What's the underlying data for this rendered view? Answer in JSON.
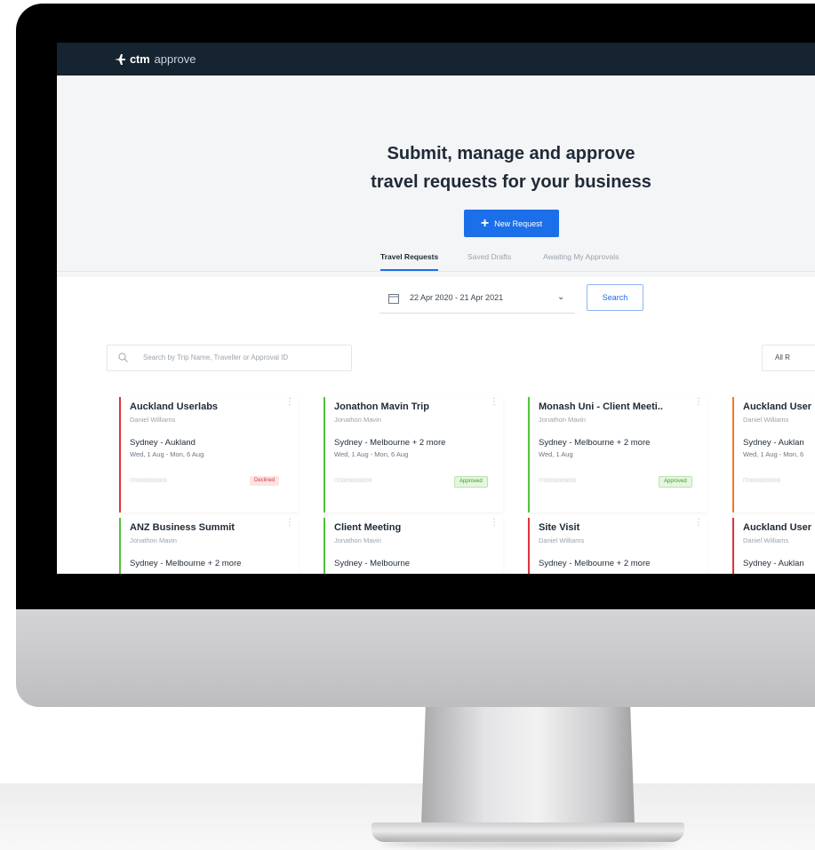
{
  "app": {
    "logo_brand": "ctm",
    "logo_product": "approve"
  },
  "hero": {
    "title_line1": "Submit, manage and approve",
    "title_line2": "travel requests for your business",
    "new_request_label": "New Request"
  },
  "tabs": [
    {
      "label": "Travel Requests",
      "active": true
    },
    {
      "label": "Saved Drafts",
      "active": false
    },
    {
      "label": "Awaiting My Approvals",
      "active": false
    }
  ],
  "filters": {
    "date_range": "22 Apr 2020 - 21 Apr 2021",
    "search_label": "Search",
    "search_placeholder": "Search by Trip Name, Traveller or Approval ID",
    "status_filter": "All R"
  },
  "colors": {
    "accent": "#1b6fe8",
    "topbar": "#162330",
    "declined": "#e0323c",
    "approved": "#52c23a",
    "pending": "#f07a2a"
  },
  "cards": [
    {
      "name": "Auckland Userlabs",
      "traveller": "Daniel Williams",
      "route": "Sydney - Aukland",
      "dates": "Wed, 1 Aug - Mon, 6 Aug",
      "ref": "IT00000000000",
      "status": "Declined",
      "color": "#e0323c"
    },
    {
      "name": "Jonathon Mavin Trip",
      "traveller": "Jonathon Mavin",
      "route": "Sydney - Melbourne + 2 more",
      "dates": "Wed, 1 Aug - Mon, 6 Aug",
      "ref": "IT00000000000",
      "status": "Approved",
      "color": "#52c23a"
    },
    {
      "name": "Monash Uni - Client Meeti..",
      "traveller": "Jonathon Mavin",
      "route": "Sydney - Melbourne + 2 more",
      "dates": "Wed, 1 Aug",
      "ref": "IT00000000000",
      "status": "Approved",
      "color": "#52c23a"
    },
    {
      "name": "Auckland User",
      "traveller": "Daniel Williams",
      "route": "Sydney - Auklan",
      "dates": "Wed, 1 Aug - Mon, 6",
      "ref": "IT00000000000",
      "status": "",
      "color": "#f07a2a"
    },
    {
      "name": "ANZ Business Summit",
      "traveller": "Jonathon Mavin",
      "route": "Sydney - Melbourne + 2 more",
      "dates": "",
      "ref": "",
      "status": "",
      "color": "#52c23a"
    },
    {
      "name": "Client Meeting",
      "traveller": "Jonathon Mavin",
      "route": "Sydney - Melbourne",
      "dates": "",
      "ref": "",
      "status": "",
      "color": "#52c23a"
    },
    {
      "name": "Site Visit",
      "traveller": "Daniel Williams",
      "route": "Sydney - Melbourne + 2 more",
      "dates": "",
      "ref": "",
      "status": "",
      "color": "#e0323c"
    },
    {
      "name": "Auckland User",
      "traveller": "Daniel Williams",
      "route": "Sydney - Auklan",
      "dates": "",
      "ref": "",
      "status": "",
      "color": "#e0323c"
    }
  ]
}
